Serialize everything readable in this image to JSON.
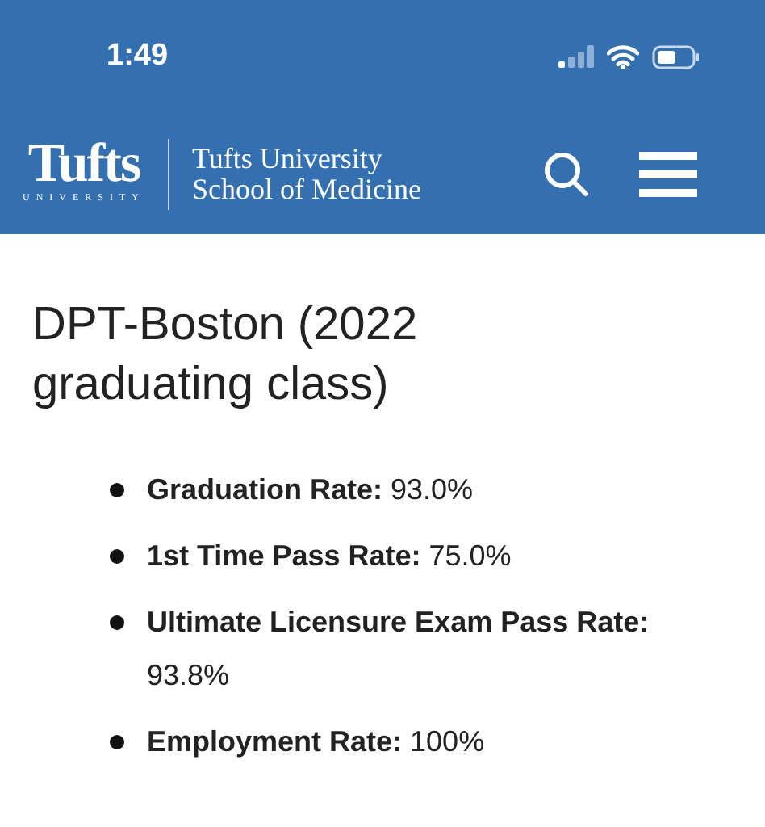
{
  "status_bar": {
    "time": "1:49"
  },
  "header": {
    "logo_wordmark": "Tufts",
    "logo_subtitle": "UNIVERSITY",
    "school_line_1": "Tufts University",
    "school_line_2": "School of Medicine"
  },
  "heading": "DPT-Boston (2022 graduating class)",
  "stats": [
    {
      "text": "**Graduation Rate:** 93.0%"
    },
    {
      "text": "**1st Time Pass Rate:** 75.0%"
    },
    {
      "text": "**Ultimate Licensure Exam Pass Rate:** 93.8%"
    },
    {
      "text": "**Employment Rate:** 100%"
    }
  ]
}
